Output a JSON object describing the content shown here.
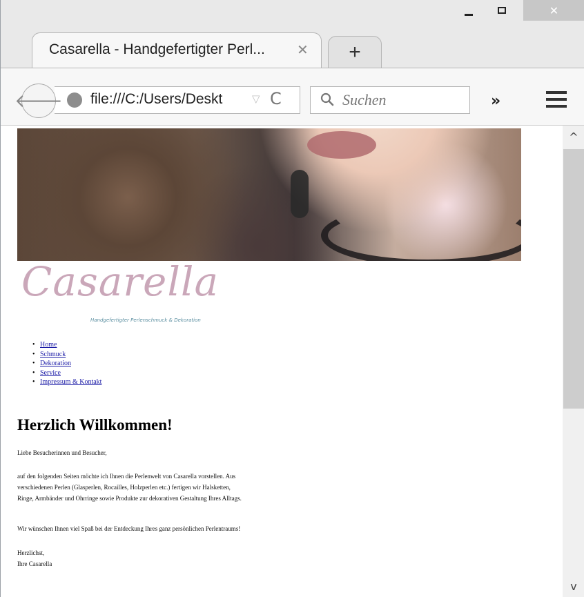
{
  "window": {
    "minimize_icon": "minimize-icon",
    "maximize_icon": "maximize-icon",
    "close_icon": "close-icon",
    "close_glyph": "✕"
  },
  "tab": {
    "title": "Casarella - Handgefertigter Perl...",
    "close_glyph": "✕",
    "new_tab_glyph": "+"
  },
  "navbar": {
    "back_glyph": "🡐",
    "url": "file:///C:/Users/Deskt",
    "dropmarker": "▽",
    "reload": "C",
    "search_placeholder": "Suchen",
    "overflow": "»"
  },
  "site": {
    "logo_text": "Casarella",
    "logo_tagline": "Handgefertigter Perlenschmuck & Dekoration",
    "nav": [
      "Home",
      "Schmuck",
      "Dekoration",
      "Service",
      "Impressum & Kontakt"
    ],
    "heading": "Herzlich Willkommen!",
    "greeting": "Liebe Besucherinnen und Besucher,",
    "intro_lines": [
      "auf den folgenden Seiten möchte ich Ihnen die Perlenwelt von Casarella vorstellen. Aus",
      "verschiedenen Perlen (Glasperlen, Rocailles, Holzperlen etc.) fertigen wir Halsketten,",
      "Ringe, Armbänder und Ohrringe sowie Produkte zur dekorativen Gestaltung Ihres Alltags."
    ],
    "wish": "Wir wünschen Ihnen viel Spaß bei der Entdeckung Ihres ganz persönlichen Perlentraums!",
    "signoff": [
      "Herzlichst,",
      "Ihre Casarella"
    ]
  },
  "scrollbar": {
    "up_glyph": "^",
    "down_glyph": "v"
  }
}
